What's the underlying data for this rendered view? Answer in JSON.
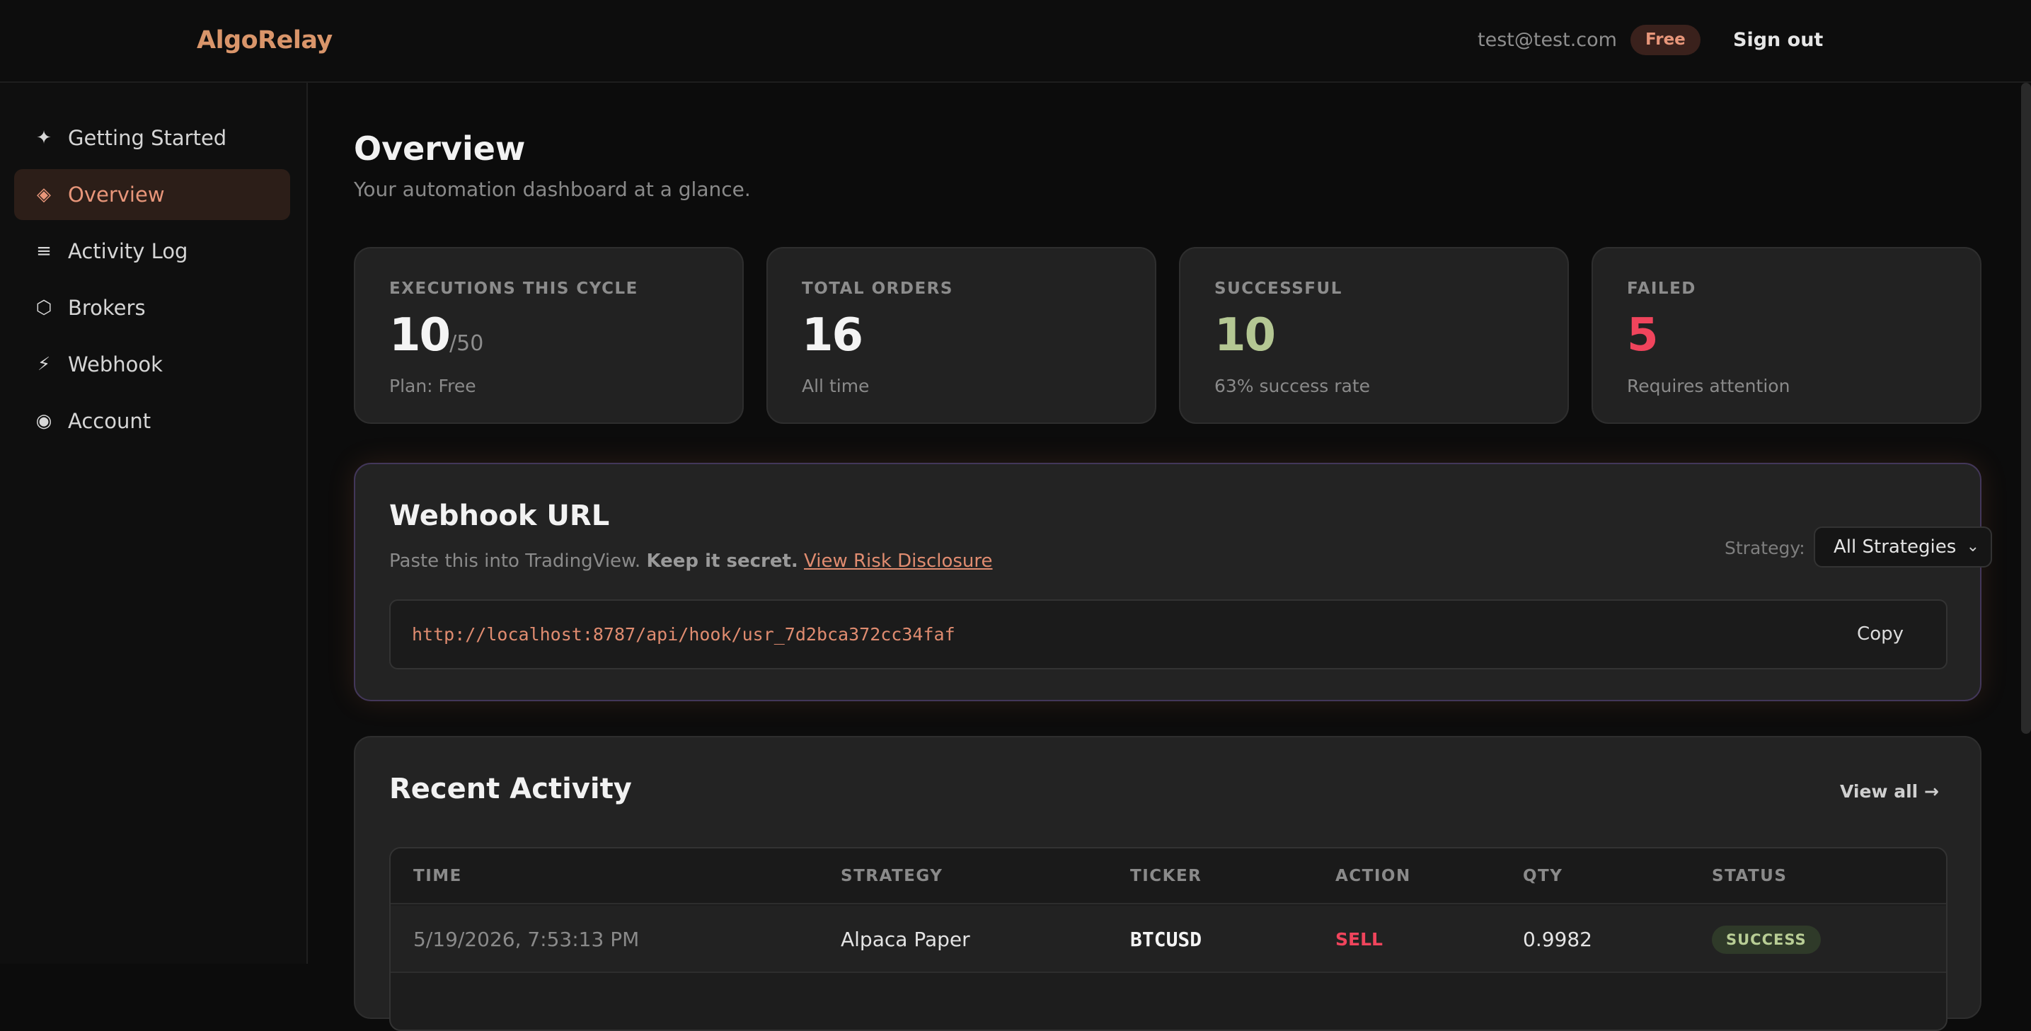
{
  "header": {
    "logo": "AlgoRelay",
    "email": "test@test.com",
    "plan_badge": "Free",
    "sign_out": "Sign out"
  },
  "sidebar": {
    "items": [
      {
        "label": "Getting Started",
        "icon": "sparkle-icon",
        "glyph": "✦"
      },
      {
        "label": "Overview",
        "icon": "diamond-icon",
        "glyph": "◈",
        "active": true
      },
      {
        "label": "Activity Log",
        "icon": "list-icon",
        "glyph": "≡"
      },
      {
        "label": "Brokers",
        "icon": "hexagon-icon",
        "glyph": "⬡"
      },
      {
        "label": "Webhook",
        "icon": "lightning-icon",
        "glyph": "⚡"
      },
      {
        "label": "Account",
        "icon": "user-circle-icon",
        "glyph": "◉"
      }
    ]
  },
  "page": {
    "title": "Overview",
    "subtitle": "Your automation dashboard at a glance."
  },
  "stats": [
    {
      "label": "EXECUTIONS THIS CYCLE",
      "value": "10",
      "suffix": "/50",
      "note": "Plan: Free"
    },
    {
      "label": "TOTAL ORDERS",
      "value": "16",
      "note": "All time"
    },
    {
      "label": "SUCCESSFUL",
      "value": "10",
      "note": "63% success rate"
    },
    {
      "label": "FAILED",
      "value": "5",
      "note": "Requires attention"
    }
  ],
  "webhook": {
    "title": "Webhook URL",
    "desc_prefix": "Paste this into TradingView. ",
    "desc_strong": "Keep it secret.",
    "desc_link": "View Risk Disclosure",
    "strategy_label": "Strategy:",
    "strategy_value": "All Strategies",
    "url": "http://localhost:8787/api/hook/usr_7d2bca372cc34faf",
    "copy_label": "Copy"
  },
  "activity": {
    "title": "Recent Activity",
    "view_all": "View all →",
    "columns": [
      "TIME",
      "STRATEGY",
      "TICKER",
      "ACTION",
      "QTY",
      "STATUS"
    ],
    "rows": [
      {
        "time": "5/19/2026, 7:53:13 PM",
        "strategy": "Alpaca Paper",
        "ticker": "BTCUSD",
        "action": "SELL",
        "qty": "0.9982",
        "status": "SUCCESS"
      }
    ]
  },
  "colors": {
    "accent": "#d9956a",
    "success": "#b4c793",
    "danger": "#f0445c",
    "background": "#0c0c0c"
  }
}
